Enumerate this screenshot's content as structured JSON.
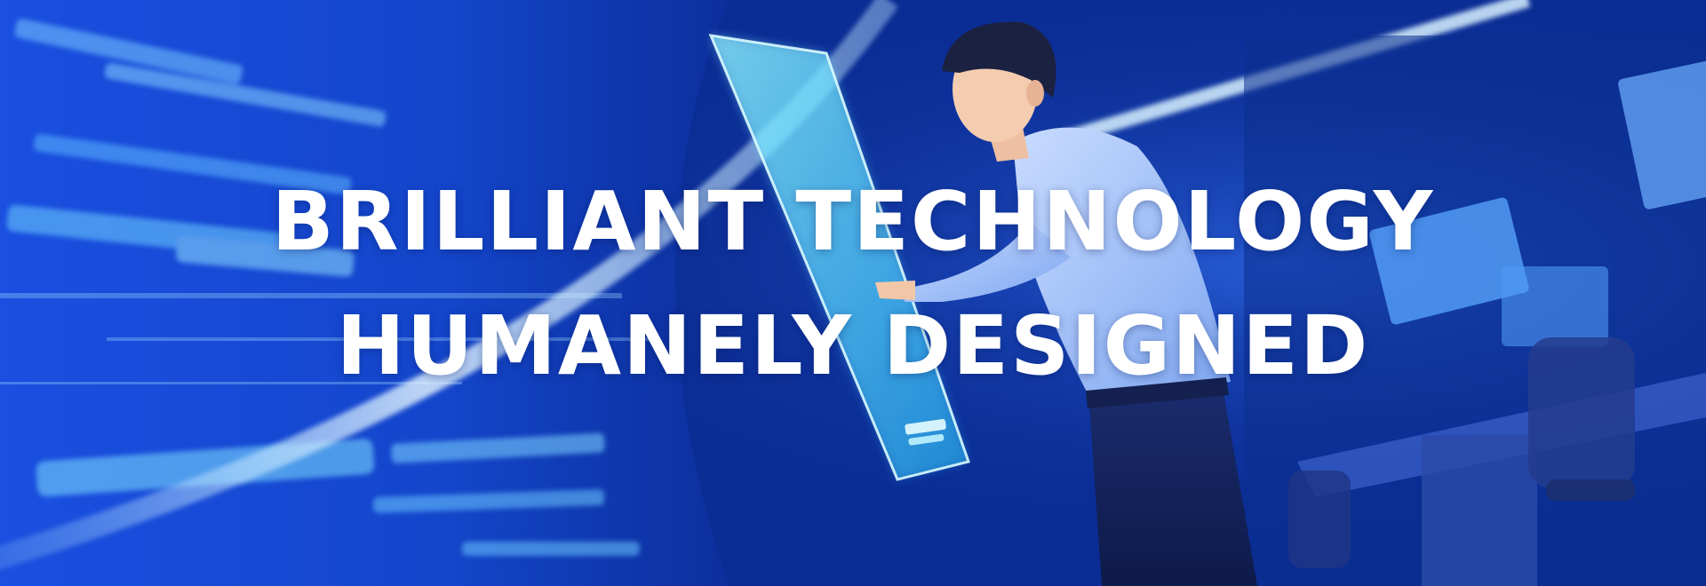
{
  "hero": {
    "headline_line1": "BRILLIANT TECHNOLOGY",
    "headline_line2": "HUMANELY DESIGNED"
  },
  "image": {
    "description_icon": "person-touching-holographic-screen-illustration",
    "colors": {
      "deep_blue": "#061f7a",
      "mid_blue": "#1e5be0",
      "glow_cyan": "#7fe6ff",
      "text_white": "#ffffff"
    }
  }
}
